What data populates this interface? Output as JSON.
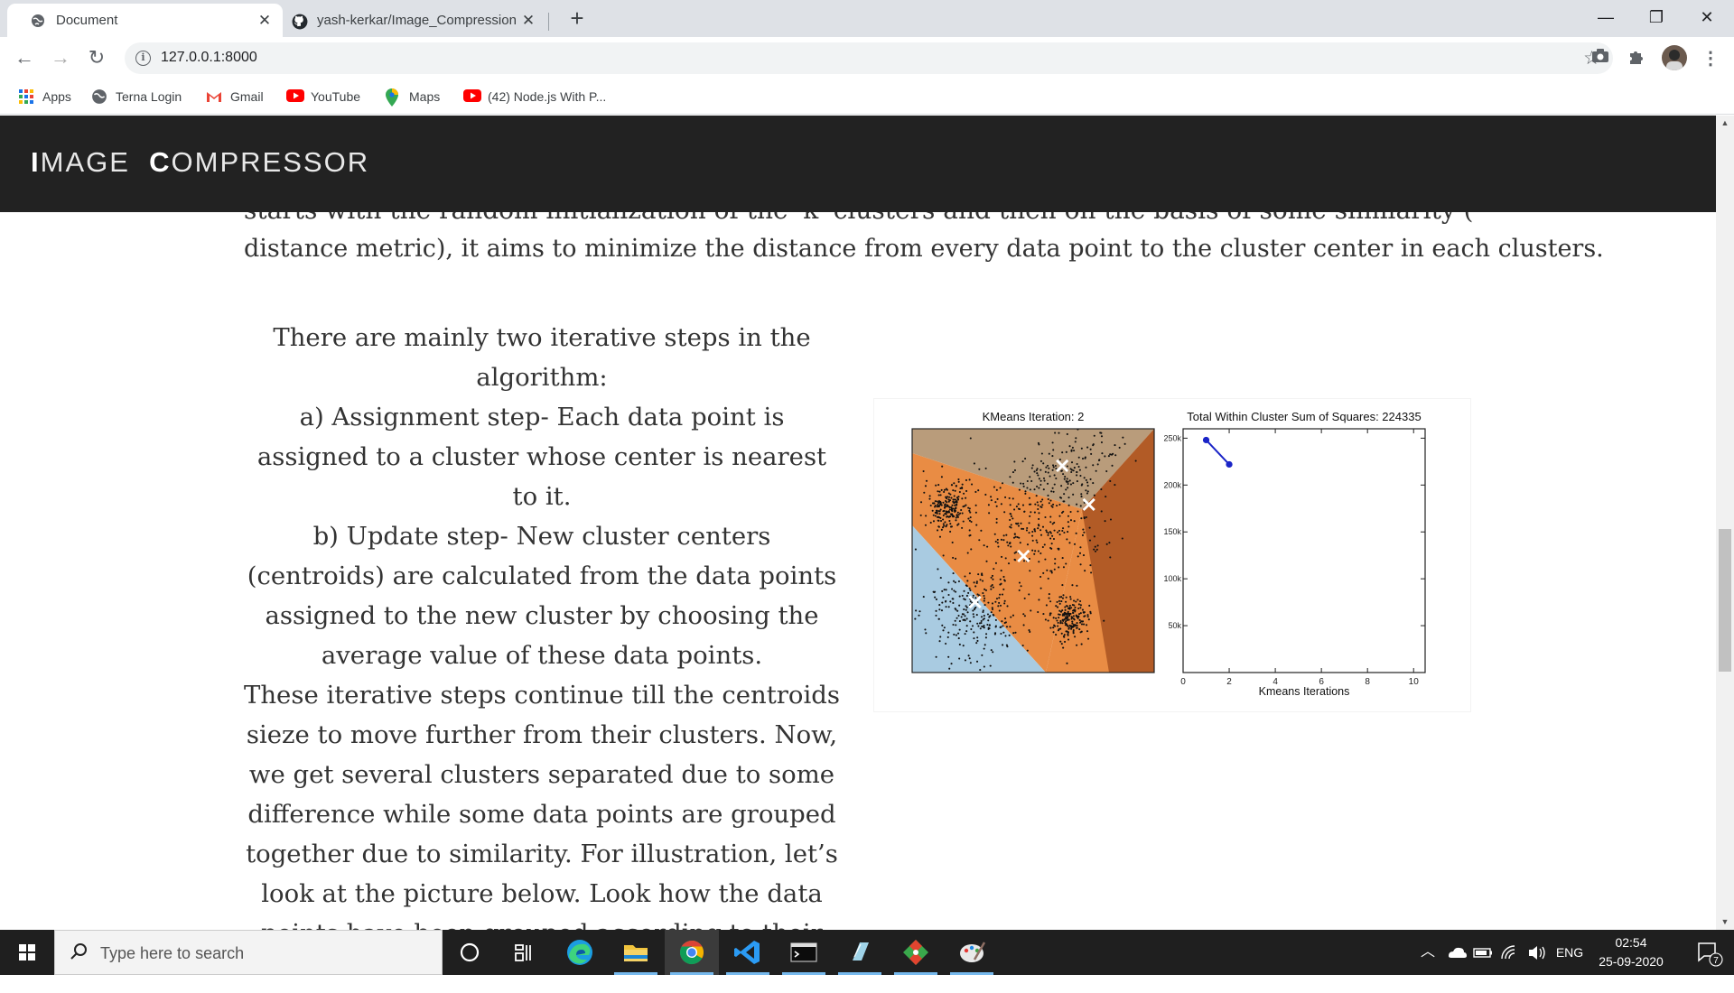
{
  "browser": {
    "tabs": [
      {
        "title": "Document",
        "active": true
      },
      {
        "title": "yash-kerkar/Image_Compression",
        "active": false
      }
    ],
    "new_tab_label": "+",
    "window_controls": {
      "minimize": "—",
      "restore": "❐",
      "close": "✕"
    },
    "url": "127.0.0.1:8000",
    "bookmarks": [
      {
        "label": "Apps",
        "icon": "apps-grid-icon"
      },
      {
        "label": "Terna Login",
        "icon": "globe-icon"
      },
      {
        "label": "Gmail",
        "icon": "gmail-icon"
      },
      {
        "label": "YouTube",
        "icon": "youtube-icon"
      },
      {
        "label": "Maps",
        "icon": "maps-pin-icon"
      },
      {
        "label": "(42) Node.js With P...",
        "icon": "youtube-icon"
      }
    ]
  },
  "site": {
    "logo_first_initial": "I",
    "logo_first_rest": "MAGE",
    "logo_second_initial": "C",
    "logo_second_rest": "OMPRESSOR"
  },
  "content": {
    "cut_line": "starts with the random initialization of the 'k' clusters and then on the basis of some similarity (like euclidean",
    "intro_tail": "distance metric), it aims to minimize the distance from every data point to the cluster center in each clusters.",
    "steps_intro": "There are mainly two iterative steps in the algorithm:",
    "step_a": "a) Assignment step- Each data point is assigned to a cluster whose center is nearest to it.",
    "step_b": "b) Update step- New cluster centers (centroids) are calculated from the data points assigned to the new cluster by choosing the average value of these data points.",
    "closing": "These iterative steps continue till the centroids sieze to move further from their clusters. Now, we get several clusters separated due to some difference while some data points are grouped together due to similarity. For illustration, let’s look at the picture below. Look how the data points have been grouped according to their distance values."
  },
  "chart_data": [
    {
      "type": "scatter",
      "title": "KMeans Iteration: 2",
      "regions": [
        {
          "color": "#b99c7b"
        },
        {
          "color": "#e98c44"
        },
        {
          "color": "#b25b26"
        },
        {
          "color": "#a9cbe1"
        }
      ],
      "clusters": [
        {
          "cx": 0.15,
          "cy": 0.68,
          "spread": 0.05,
          "n": 220
        },
        {
          "cx": 0.65,
          "cy": 0.22,
          "spread": 0.045,
          "n": 200
        },
        {
          "cx": 0.26,
          "cy": 0.25,
          "spread": 0.1,
          "n": 260
        },
        {
          "cx": 0.52,
          "cy": 0.62,
          "spread": 0.14,
          "n": 330
        },
        {
          "cx": 0.68,
          "cy": 0.88,
          "spread": 0.09,
          "n": 110
        }
      ],
      "centroids": [
        {
          "x": 0.62,
          "y": 0.85
        },
        {
          "x": 0.73,
          "y": 0.69
        },
        {
          "x": 0.46,
          "y": 0.48
        },
        {
          "x": 0.26,
          "y": 0.29
        }
      ],
      "centroid_marker": "×"
    },
    {
      "type": "line",
      "title": "Total Within Cluster Sum of Squares: 224335",
      "xlabel": "Kmeans Iterations",
      "ylabel": "",
      "x": [
        1,
        2
      ],
      "y": [
        248000,
        222000
      ],
      "xlim": [
        0,
        10.5
      ],
      "ylim": [
        0,
        260000
      ],
      "xticks": [
        0,
        2,
        4,
        6,
        8,
        10
      ],
      "yticks": [
        {
          "value": 50000,
          "label": "50k"
        },
        {
          "value": 100000,
          "label": "100k"
        },
        {
          "value": 150000,
          "label": "150k"
        },
        {
          "value": 200000,
          "label": "200k"
        },
        {
          "value": 250000,
          "label": "250k"
        }
      ],
      "line_color": "#1a24c7"
    }
  ],
  "taskbar": {
    "search_placeholder": "Type here to search",
    "apps": [
      {
        "icon": "cortana-icon"
      },
      {
        "icon": "task-view-icon"
      },
      {
        "icon": "edge-icon"
      },
      {
        "icon": "file-explorer-icon"
      },
      {
        "icon": "chrome-icon"
      },
      {
        "icon": "vscode-icon"
      },
      {
        "icon": "terminal-icon"
      },
      {
        "icon": "notepad-icon"
      },
      {
        "icon": "git-icon"
      },
      {
        "icon": "paint-icon"
      }
    ],
    "tray": {
      "language": "ENG",
      "time": "02:54",
      "date": "25-09-2020",
      "notifications": "7"
    }
  }
}
